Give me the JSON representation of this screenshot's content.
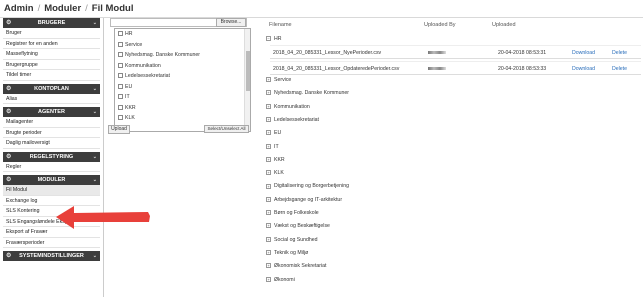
{
  "breadcrumb": [
    "Admin",
    "Moduler",
    "Fil Modul"
  ],
  "sidebar": {
    "sections": [
      {
        "title": "BRUGERE",
        "items": [
          "Bruger",
          "Registrer for en anden",
          "Masseflytning",
          "Brugergruppe",
          "Tildel timer"
        ]
      },
      {
        "title": "KONTOPLAN",
        "items": [
          "Alias"
        ]
      },
      {
        "title": "AGENTER",
        "items": [
          "Mailagenter",
          "Brugte perioder",
          "Daglig mailoversigt"
        ]
      },
      {
        "title": "REGELSTYRING",
        "items": [
          "Regler"
        ]
      },
      {
        "title": "MODULER",
        "items": [
          "Fil Modul",
          "Exchange log",
          "SLS Kontering",
          "SLS Engangsløndele Eksport",
          "Eksport af Fravær",
          "Fraværsperioder"
        ]
      },
      {
        "title": "SYSTEMINDSTILLINGER",
        "items": []
      }
    ],
    "active_item": "Fil Modul"
  },
  "upload": {
    "browse_label": "Browse...",
    "file_value": "",
    "checklist": [
      "HR",
      "Service",
      "Nyhedsmag. Danske Kommuner",
      "Kommunikation",
      "Ledelsessekretariat",
      "EU",
      "IT",
      "KKR",
      "KLK"
    ],
    "upload_label": "Upload",
    "select_all_label": "Select/Unselect All"
  },
  "table": {
    "headers": {
      "filename": "Filename",
      "uploaded_by": "Uploaded By",
      "uploaded": "Uploaded"
    },
    "open_group": "HR",
    "open_group_toggle": "−",
    "files": [
      {
        "filename": "2018_04_20_085331_Lessor_NyePerioder.csv",
        "uploaded": "20-04-2018 08:53:31",
        "download": "Download",
        "delete": "Delete"
      },
      {
        "filename": "2018_04_20_085331_Lessor_OpdateredePerioder.csv",
        "uploaded": "20-04-2018 08:53:33",
        "download": "Download",
        "delete": "Delete"
      }
    ],
    "groups": [
      "Service",
      "Nyhedsmag. Danske Kommuner",
      "Kommunikation",
      "Ledelsessekretariat",
      "EU",
      "IT",
      "KKR",
      "KLK",
      "Digitalisering og Borgerbetjening",
      "Arbejdsgange og IT-arkitektur",
      "Børn og Folkeskole",
      "Vækst og Beskæftigelse",
      "Social og Sundhed",
      "Teknik og Miljø",
      "Økonomisk Sekretariat",
      "Økonomi"
    ],
    "group_toggle": "+"
  },
  "colors": {
    "section_bg": "#3d3d3d",
    "link": "#2a6ebb",
    "arrow": "#e8403a"
  },
  "icons": {
    "section": "gear-icon",
    "chevron": "chevron-down-icon",
    "arrow": "red-pointer-arrow"
  }
}
